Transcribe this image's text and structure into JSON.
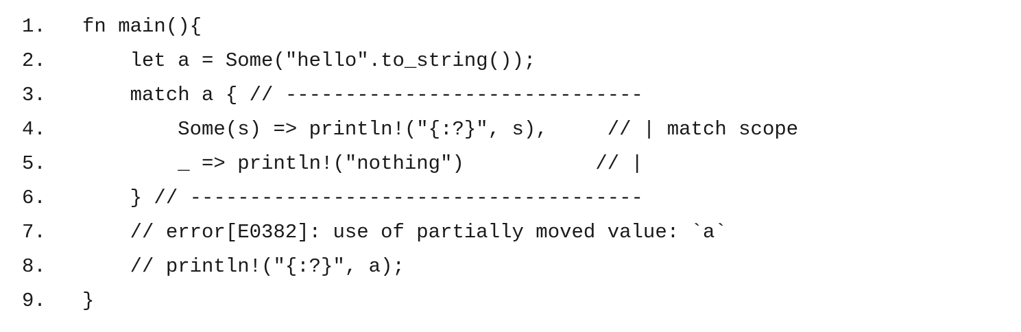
{
  "code": {
    "lines": [
      {
        "number": "1.",
        "text": "fn main(){"
      },
      {
        "number": "2.",
        "text": "    let a = Some(\"hello\".to_string());"
      },
      {
        "number": "3.",
        "text": "    match a { // ------------------------------"
      },
      {
        "number": "4.",
        "text": "        Some(s) => println!(\"{:?}\", s),     // | match scope"
      },
      {
        "number": "5.",
        "text": "        _ => println!(\"nothing\")           // |"
      },
      {
        "number": "6.",
        "text": "    } // --------------------------------------"
      },
      {
        "number": "7.",
        "text": "    // error[E0382]: use of partially moved value: `a`"
      },
      {
        "number": "8.",
        "text": "    // println!(\"{:?}\", a);"
      },
      {
        "number": "9.",
        "text": "}"
      }
    ]
  }
}
